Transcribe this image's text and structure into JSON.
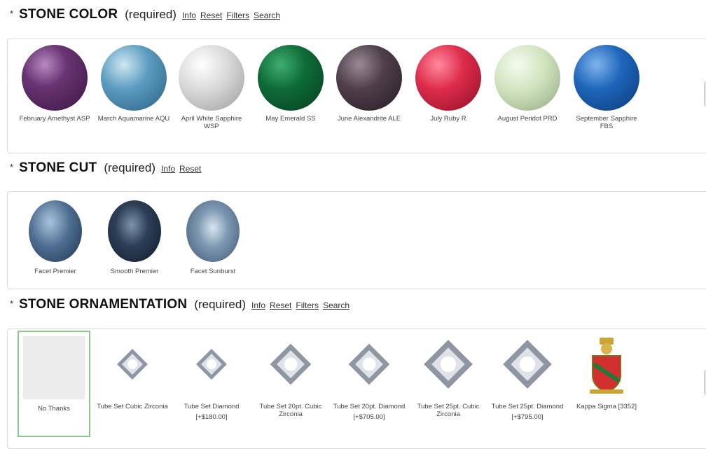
{
  "color_section": {
    "title": "STONE COLOR",
    "required": "(required)",
    "links": [
      "Info",
      "Reset",
      "Filters",
      "Search"
    ],
    "options": [
      {
        "label": "February Amethyst ASP",
        "color": "#5a2a60"
      },
      {
        "label": "March Aquamarine AQU",
        "color": "#4f8db0"
      },
      {
        "label": "April White Sapphire WSP",
        "color": "#c9c9c9"
      },
      {
        "label": "May Emerald SS",
        "color": "#0f6b3a"
      },
      {
        "label": "June Alexandrite ALE",
        "color": "#4a3a44"
      },
      {
        "label": "July Ruby R",
        "color": "#d82a48"
      },
      {
        "label": "August Peridot PRD",
        "color": "#cfe0bf"
      },
      {
        "label": "September Sapphire FBS",
        "color": "#1f64b8"
      }
    ]
  },
  "cut_section": {
    "title": "STONE CUT",
    "required": "(required)",
    "links": [
      "Info",
      "Reset"
    ],
    "options": [
      {
        "label": "Facet Premier"
      },
      {
        "label": "Smooth Premier"
      },
      {
        "label": "Facet Sunburst"
      }
    ]
  },
  "ornament_section": {
    "title": "STONE ORNAMENTATION",
    "required": "(required)",
    "links": [
      "Info",
      "Reset",
      "Filters",
      "Search"
    ],
    "options": [
      {
        "label": "No Thanks",
        "price": ""
      },
      {
        "label": "Tube Set Cubic Zirconia",
        "price": ""
      },
      {
        "label": "Tube Set Diamond",
        "price": "[+$180.00]"
      },
      {
        "label": "Tube Set 20pt. Cubic Zirconia",
        "price": ""
      },
      {
        "label": "Tube Set 20pt. Diamond",
        "price": "[+$705.00]"
      },
      {
        "label": "Tube Set 25pt. Cubic Zirconia",
        "price": ""
      },
      {
        "label": "Tube Set 25pt. Diamond",
        "price": "[+$795.00]"
      },
      {
        "label": "Kappa Sigma [3352]",
        "price": ""
      }
    ]
  }
}
